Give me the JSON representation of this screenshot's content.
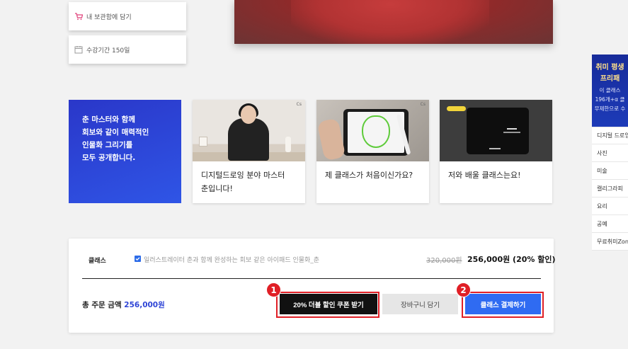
{
  "side_cards": [
    {
      "label": "내 보관함에 담기",
      "icon": "cart-icon"
    },
    {
      "label": "수강기간 150일",
      "icon": "calendar-icon"
    }
  ],
  "promo": {
    "text": "춘 마스터와 함께\n회보와 같이 매력적인\n인물화 그리기를\n모두 공개합니다."
  },
  "video_cards": [
    {
      "caption": "디지털드로잉 분야 마스터\n춘입니다!",
      "badge": "Cs"
    },
    {
      "caption": "제 클래스가 처음이신가요?",
      "badge": "Cs"
    },
    {
      "caption": "저와 배울 클래스는요!"
    }
  ],
  "right_banner": {
    "line1": "취미 평생",
    "line2": "프리패",
    "line3": "이 클래스",
    "line4": "196개+α 클",
    "line5": "무제한으로 수"
  },
  "categories": [
    "디지털 드로잉",
    "사진",
    "미술",
    "캘리그라피",
    "요리",
    "공예",
    "무료취미Zone"
  ],
  "order": {
    "class_label": "클래스",
    "course_name": "일러스트레이터 춘과 함께 완성하는 회보 같은 아이패드 인물화_춘",
    "original_price": "320,000원",
    "discount_price": "256,000원 (20% 할인)",
    "total_label": "총 주문 금액",
    "total_amount": "256,000원",
    "coupon_button": "20% 더블 할인 쿠폰 받기",
    "cart_button": "장바구니 담기",
    "pay_button": "클래스 결제하기"
  },
  "annotations": {
    "badge1": "1",
    "badge2": "2"
  },
  "colors": {
    "accent_blue": "#2f6bf2",
    "highlight_red": "#e01f26",
    "promo_blue": "#2a37c9"
  }
}
